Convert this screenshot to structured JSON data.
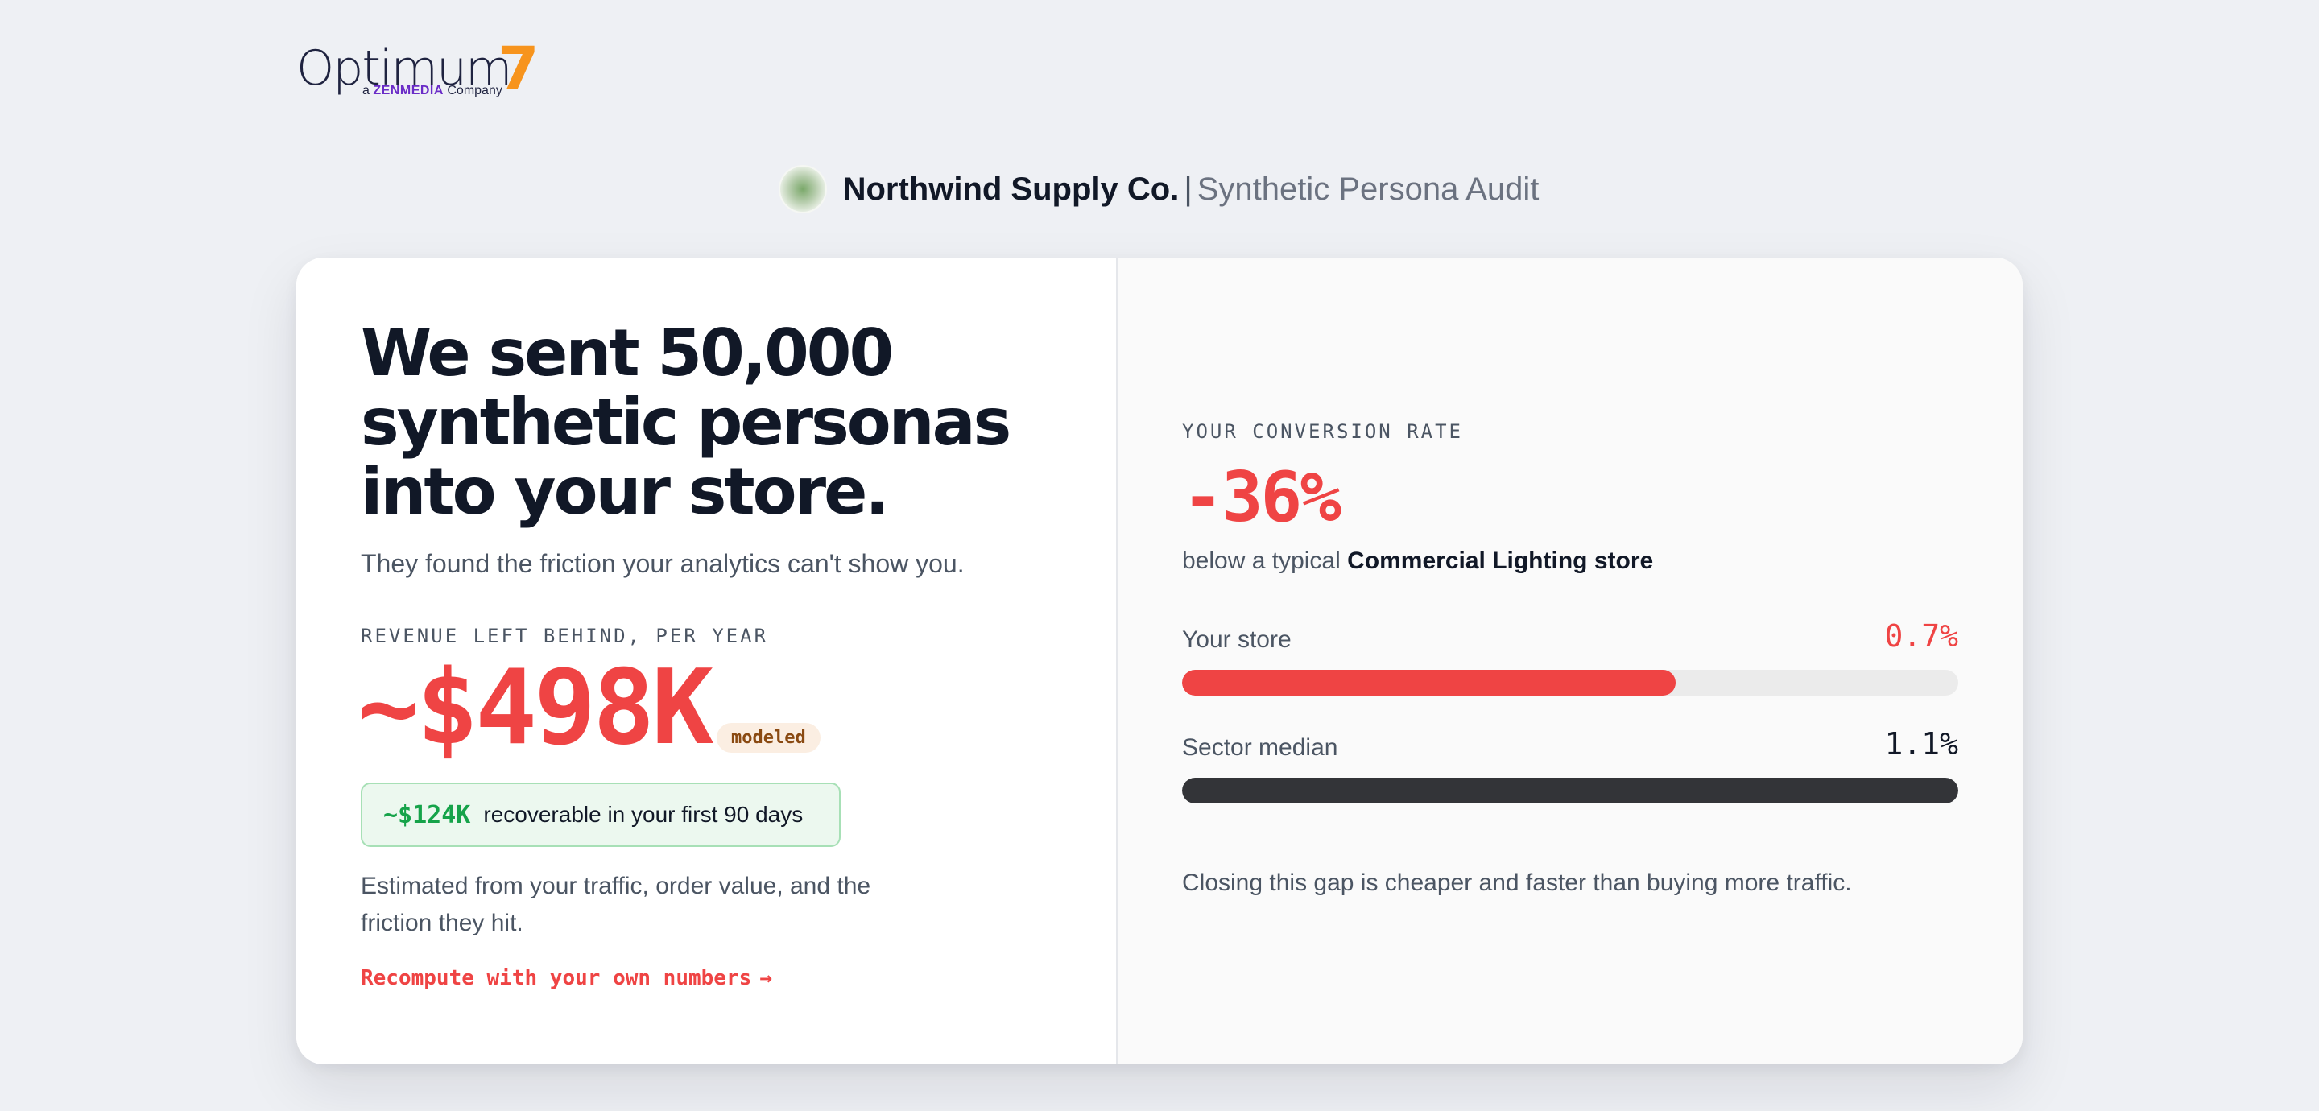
{
  "logo": {
    "wordmark": "Optimum",
    "numeral": "7",
    "tagline_prefix": "a",
    "tagline_brand": "ZENMEDIA",
    "tagline_suffix": "Company"
  },
  "header": {
    "company_name": "Northwind Supply Co.",
    "separator": "|",
    "subtitle": "Synthetic Persona Audit"
  },
  "left": {
    "headline": "We sent 50,000 synthetic personas into your store.",
    "subhead": "They found the friction your analytics can't show you.",
    "revenue_label": "REVENUE LEFT BEHIND, PER YEAR",
    "revenue_value": "~$498K",
    "modeled_badge": "modeled",
    "recoverable_amount": "~$124K",
    "recoverable_text": "recoverable in your first 90 days",
    "estimate_text": "Estimated from your traffic, order value, and the friction they hit.",
    "recompute_link": "Recompute with your own numbers",
    "recompute_arrow": "→"
  },
  "right": {
    "conversion_label": "YOUR CONVERSION RATE",
    "conversion_delta": "-36%",
    "comparison_prefix": "below a typical",
    "comparison_store_type": "Commercial Lighting store",
    "bars": [
      {
        "label": "Your store",
        "value_text": "0.7%",
        "fill_fraction": 0.636,
        "color": "#ef4444"
      },
      {
        "label": "Sector median",
        "value_text": "1.1%",
        "fill_fraction": 1.0,
        "color": "#333438"
      }
    ],
    "closing_text": "Closing this gap is cheaper and faster than buying more traffic."
  },
  "colors": {
    "accent_red": "#ef4444",
    "success_green": "#16a34a",
    "logo_orange": "#f7941d",
    "logo_purple": "#6a2cc7",
    "background": "#eef0f4"
  }
}
